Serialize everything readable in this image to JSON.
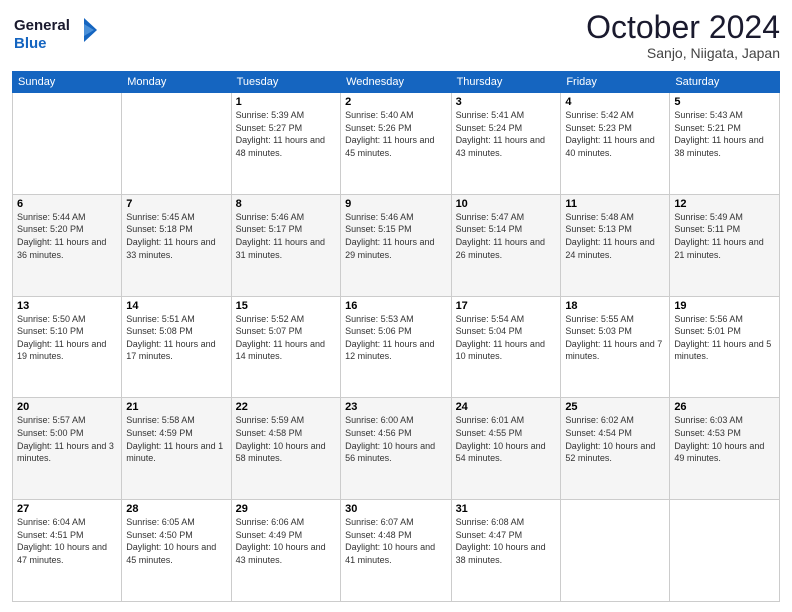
{
  "header": {
    "logo_line1": "General",
    "logo_line2": "Blue",
    "month": "October 2024",
    "location": "Sanjo, Niigata, Japan"
  },
  "days_of_week": [
    "Sunday",
    "Monday",
    "Tuesday",
    "Wednesday",
    "Thursday",
    "Friday",
    "Saturday"
  ],
  "weeks": [
    [
      null,
      null,
      {
        "day": 1,
        "sunrise": "Sunrise: 5:39 AM",
        "sunset": "Sunset: 5:27 PM",
        "daylight": "Daylight: 11 hours and 48 minutes."
      },
      {
        "day": 2,
        "sunrise": "Sunrise: 5:40 AM",
        "sunset": "Sunset: 5:26 PM",
        "daylight": "Daylight: 11 hours and 45 minutes."
      },
      {
        "day": 3,
        "sunrise": "Sunrise: 5:41 AM",
        "sunset": "Sunset: 5:24 PM",
        "daylight": "Daylight: 11 hours and 43 minutes."
      },
      {
        "day": 4,
        "sunrise": "Sunrise: 5:42 AM",
        "sunset": "Sunset: 5:23 PM",
        "daylight": "Daylight: 11 hours and 40 minutes."
      },
      {
        "day": 5,
        "sunrise": "Sunrise: 5:43 AM",
        "sunset": "Sunset: 5:21 PM",
        "daylight": "Daylight: 11 hours and 38 minutes."
      }
    ],
    [
      {
        "day": 6,
        "sunrise": "Sunrise: 5:44 AM",
        "sunset": "Sunset: 5:20 PM",
        "daylight": "Daylight: 11 hours and 36 minutes."
      },
      {
        "day": 7,
        "sunrise": "Sunrise: 5:45 AM",
        "sunset": "Sunset: 5:18 PM",
        "daylight": "Daylight: 11 hours and 33 minutes."
      },
      {
        "day": 8,
        "sunrise": "Sunrise: 5:46 AM",
        "sunset": "Sunset: 5:17 PM",
        "daylight": "Daylight: 11 hours and 31 minutes."
      },
      {
        "day": 9,
        "sunrise": "Sunrise: 5:46 AM",
        "sunset": "Sunset: 5:15 PM",
        "daylight": "Daylight: 11 hours and 29 minutes."
      },
      {
        "day": 10,
        "sunrise": "Sunrise: 5:47 AM",
        "sunset": "Sunset: 5:14 PM",
        "daylight": "Daylight: 11 hours and 26 minutes."
      },
      {
        "day": 11,
        "sunrise": "Sunrise: 5:48 AM",
        "sunset": "Sunset: 5:13 PM",
        "daylight": "Daylight: 11 hours and 24 minutes."
      },
      {
        "day": 12,
        "sunrise": "Sunrise: 5:49 AM",
        "sunset": "Sunset: 5:11 PM",
        "daylight": "Daylight: 11 hours and 21 minutes."
      }
    ],
    [
      {
        "day": 13,
        "sunrise": "Sunrise: 5:50 AM",
        "sunset": "Sunset: 5:10 PM",
        "daylight": "Daylight: 11 hours and 19 minutes."
      },
      {
        "day": 14,
        "sunrise": "Sunrise: 5:51 AM",
        "sunset": "Sunset: 5:08 PM",
        "daylight": "Daylight: 11 hours and 17 minutes."
      },
      {
        "day": 15,
        "sunrise": "Sunrise: 5:52 AM",
        "sunset": "Sunset: 5:07 PM",
        "daylight": "Daylight: 11 hours and 14 minutes."
      },
      {
        "day": 16,
        "sunrise": "Sunrise: 5:53 AM",
        "sunset": "Sunset: 5:06 PM",
        "daylight": "Daylight: 11 hours and 12 minutes."
      },
      {
        "day": 17,
        "sunrise": "Sunrise: 5:54 AM",
        "sunset": "Sunset: 5:04 PM",
        "daylight": "Daylight: 11 hours and 10 minutes."
      },
      {
        "day": 18,
        "sunrise": "Sunrise: 5:55 AM",
        "sunset": "Sunset: 5:03 PM",
        "daylight": "Daylight: 11 hours and 7 minutes."
      },
      {
        "day": 19,
        "sunrise": "Sunrise: 5:56 AM",
        "sunset": "Sunset: 5:01 PM",
        "daylight": "Daylight: 11 hours and 5 minutes."
      }
    ],
    [
      {
        "day": 20,
        "sunrise": "Sunrise: 5:57 AM",
        "sunset": "Sunset: 5:00 PM",
        "daylight": "Daylight: 11 hours and 3 minutes."
      },
      {
        "day": 21,
        "sunrise": "Sunrise: 5:58 AM",
        "sunset": "Sunset: 4:59 PM",
        "daylight": "Daylight: 11 hours and 1 minute."
      },
      {
        "day": 22,
        "sunrise": "Sunrise: 5:59 AM",
        "sunset": "Sunset: 4:58 PM",
        "daylight": "Daylight: 10 hours and 58 minutes."
      },
      {
        "day": 23,
        "sunrise": "Sunrise: 6:00 AM",
        "sunset": "Sunset: 4:56 PM",
        "daylight": "Daylight: 10 hours and 56 minutes."
      },
      {
        "day": 24,
        "sunrise": "Sunrise: 6:01 AM",
        "sunset": "Sunset: 4:55 PM",
        "daylight": "Daylight: 10 hours and 54 minutes."
      },
      {
        "day": 25,
        "sunrise": "Sunrise: 6:02 AM",
        "sunset": "Sunset: 4:54 PM",
        "daylight": "Daylight: 10 hours and 52 minutes."
      },
      {
        "day": 26,
        "sunrise": "Sunrise: 6:03 AM",
        "sunset": "Sunset: 4:53 PM",
        "daylight": "Daylight: 10 hours and 49 minutes."
      }
    ],
    [
      {
        "day": 27,
        "sunrise": "Sunrise: 6:04 AM",
        "sunset": "Sunset: 4:51 PM",
        "daylight": "Daylight: 10 hours and 47 minutes."
      },
      {
        "day": 28,
        "sunrise": "Sunrise: 6:05 AM",
        "sunset": "Sunset: 4:50 PM",
        "daylight": "Daylight: 10 hours and 45 minutes."
      },
      {
        "day": 29,
        "sunrise": "Sunrise: 6:06 AM",
        "sunset": "Sunset: 4:49 PM",
        "daylight": "Daylight: 10 hours and 43 minutes."
      },
      {
        "day": 30,
        "sunrise": "Sunrise: 6:07 AM",
        "sunset": "Sunset: 4:48 PM",
        "daylight": "Daylight: 10 hours and 41 minutes."
      },
      {
        "day": 31,
        "sunrise": "Sunrise: 6:08 AM",
        "sunset": "Sunset: 4:47 PM",
        "daylight": "Daylight: 10 hours and 38 minutes."
      },
      null,
      null
    ]
  ]
}
